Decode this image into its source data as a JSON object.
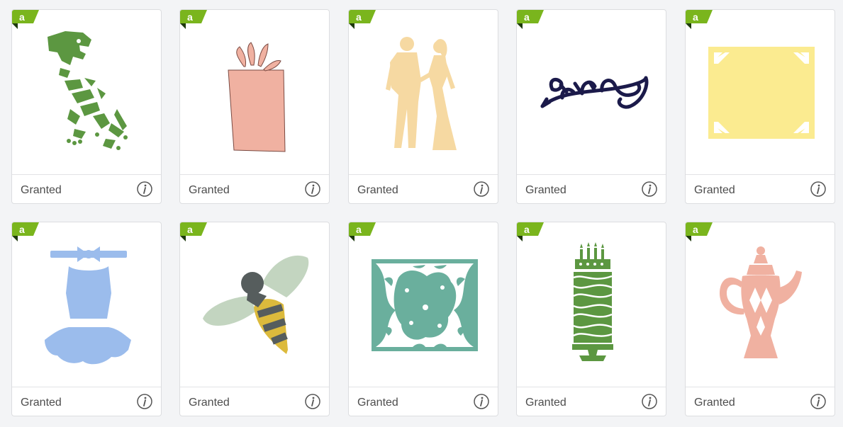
{
  "grid": {
    "cards": [
      {
        "id": "dino-skeleton",
        "label": "Granted",
        "badge_icon": "access-badge-icon",
        "image_icon": "dinosaur-skeleton-icon",
        "color": "#5c9741"
      },
      {
        "id": "gift-box",
        "label": "Granted",
        "badge_icon": "access-badge-icon",
        "image_icon": "gift-box-icon",
        "color": "#f0b1a1"
      },
      {
        "id": "dancing-couple",
        "label": "Granted",
        "badge_icon": "access-badge-icon",
        "image_icon": "couple-silhouette-icon",
        "color": "#f6d9a2"
      },
      {
        "id": "flourish",
        "label": "Granted",
        "badge_icon": "access-badge-icon",
        "image_icon": "flourish-icon",
        "color": "#1b1a4a"
      },
      {
        "id": "square-frame",
        "label": "Granted",
        "badge_icon": "access-badge-icon",
        "image_icon": "square-frame-icon",
        "color": "#fbeb90"
      },
      {
        "id": "tutu-dress",
        "label": "Granted",
        "badge_icon": "access-badge-icon",
        "image_icon": "tutu-dress-icon",
        "color": "#9bbcec"
      },
      {
        "id": "bee",
        "label": "Granted",
        "badge_icon": "access-badge-icon",
        "image_icon": "bee-icon",
        "color": "#dcba3c"
      },
      {
        "id": "lace-panel",
        "label": "Granted",
        "badge_icon": "access-badge-icon",
        "image_icon": "lace-panel-icon",
        "color": "#6aaf9d"
      },
      {
        "id": "birthday-cake",
        "label": "Granted",
        "badge_icon": "access-badge-icon",
        "image_icon": "cake-icon",
        "color": "#5c9741"
      },
      {
        "id": "teapot",
        "label": "Granted",
        "badge_icon": "access-badge-icon",
        "image_icon": "teapot-icon",
        "color": "#f0b1a1"
      }
    ],
    "badge_color": "#7ab51d",
    "info_icon": "info-icon"
  }
}
